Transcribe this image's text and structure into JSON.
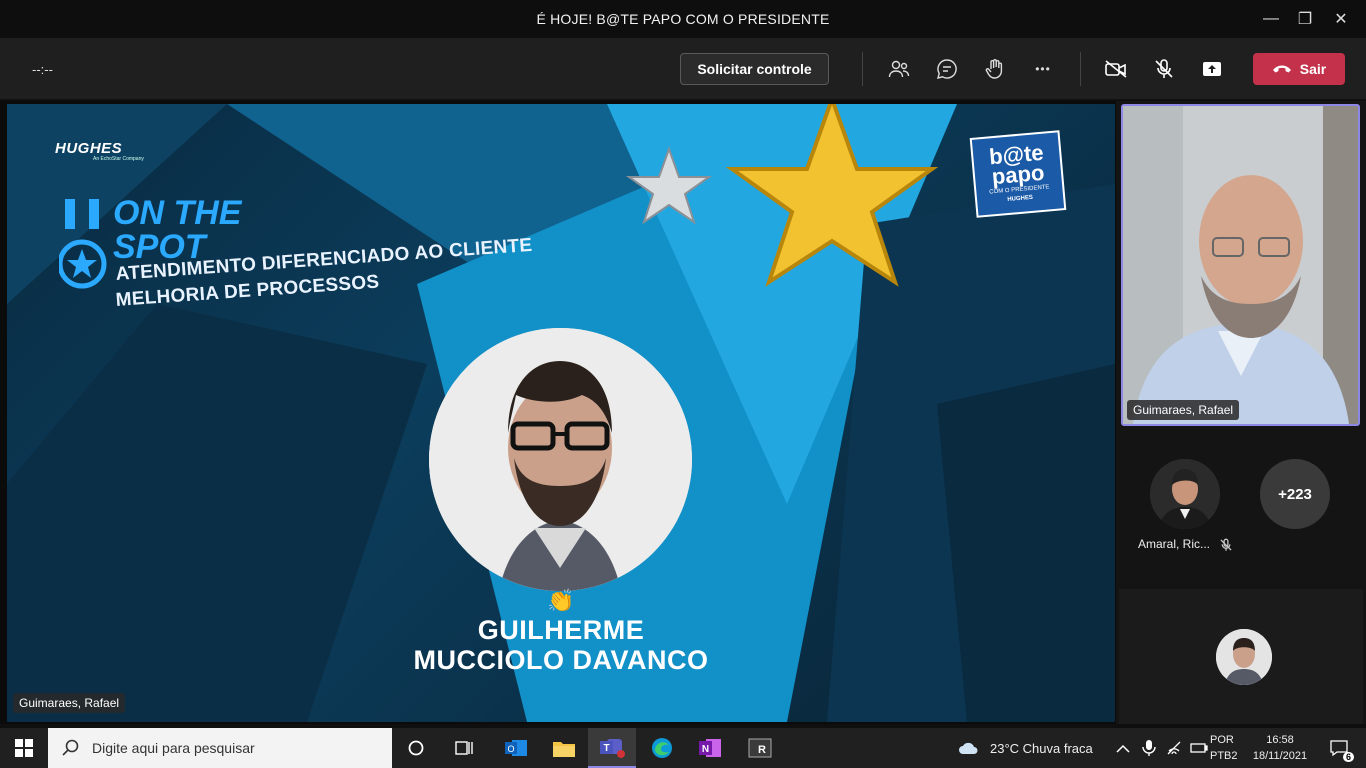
{
  "window": {
    "title": "É HOJE! B@TE PAPO COM O PRESIDENTE",
    "minimize": "—",
    "maximize": "❐",
    "close": "✕"
  },
  "toolbar": {
    "timer": "--:--",
    "request_control": "Solicitar controle",
    "leave": "Sair",
    "icons": [
      "people-icon",
      "chat-icon",
      "raise-hand-icon",
      "more-icon",
      "camera-off-icon",
      "mic-off-icon",
      "share-icon",
      "phone-icon"
    ],
    "more_glyph": "•••"
  },
  "slide": {
    "brand": "HUGHES",
    "brand_sub": "An EchoStar Company",
    "headline": [
      "ON THE",
      "SPOT"
    ],
    "subline1": "ATENDIMENTO DIFERENCIADO AO CLIENTE",
    "subline2": "MELHORIA DE PROCESSOS",
    "name1": "GUILHERME",
    "name2": "MUCCIOLO DAVANCO",
    "hand": "👏",
    "bp_title1": "b@te",
    "bp_title2": "papo",
    "bp_sub": "COM O PRESIDENTE",
    "bp_brand": "HUGHES",
    "presenter_label": "Guimaraes, Rafael"
  },
  "side": {
    "main_label": "Guimaraes, Rafael",
    "participant1": "Amaral, Ric...",
    "more_count": "+223"
  },
  "taskbar": {
    "search_placeholder": "Digite aqui para pesquisar",
    "weather": "23°C  Chuva fraca",
    "lang1": "POR",
    "lang2": "PTB2",
    "time": "16:58",
    "date": "18/11/2021",
    "notif": "6"
  },
  "colors": {
    "accent": "#2aa9ff",
    "leave": "#c4314b",
    "highlight": "#8d87e6"
  }
}
